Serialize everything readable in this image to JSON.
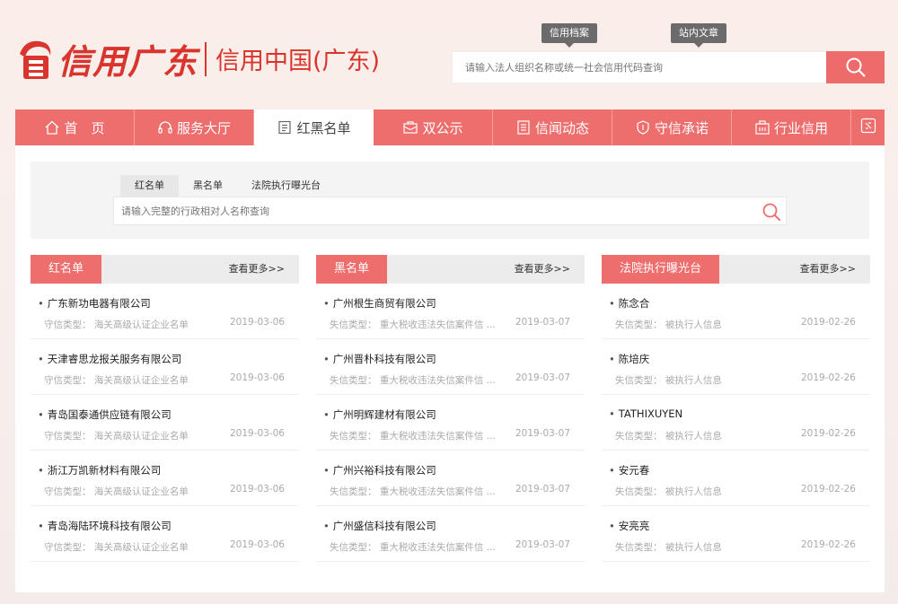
{
  "header": {
    "logo_script": "信用广东",
    "logo_sub": "信用中国(广东)",
    "top_tabs": [
      {
        "label": "信用档案"
      },
      {
        "label": "站内文章"
      }
    ],
    "search": {
      "placeholder": "请输入法人组织名称或统一社会信用代码查询"
    }
  },
  "nav": {
    "items": [
      {
        "label": "首　页",
        "icon": "home-icon"
      },
      {
        "label": "服务大厅",
        "icon": "headset-icon"
      },
      {
        "label": "红黑名单",
        "icon": "list-icon",
        "active": true
      },
      {
        "label": "双公示",
        "icon": "mail-icon"
      },
      {
        "label": "信闻动态",
        "icon": "document-icon"
      },
      {
        "label": "守信承诺",
        "icon": "shield-icon"
      },
      {
        "label": "行业信用",
        "icon": "building-icon"
      }
    ],
    "end_icon": "collapse-icon"
  },
  "search_panel": {
    "tabs": [
      "红名单",
      "黑名单",
      "法院执行曝光台"
    ],
    "active_tab": "红名单",
    "placeholder": "请输入完整的行政相对人名称查询"
  },
  "columns": [
    {
      "title": "红名单",
      "more": "查看更多>>",
      "items": [
        {
          "name": "广东新功电器有限公司",
          "sub": "守信类型：  海关高级认证企业名单",
          "date": "2019-03-06"
        },
        {
          "name": "天津睿思龙报关服务有限公司",
          "sub": "守信类型：  海关高级认证企业名单",
          "date": "2019-03-06"
        },
        {
          "name": "青岛国泰通供应链有限公司",
          "sub": "守信类型：  海关高级认证企业名单",
          "date": "2019-03-06"
        },
        {
          "name": "浙江万凯新材料有限公司",
          "sub": "守信类型：  海关高级认证企业名单",
          "date": "2019-03-06"
        },
        {
          "name": "青岛海陆环境科技有限公司",
          "sub": "守信类型：  海关高级认证企业名单",
          "date": "2019-03-06"
        }
      ]
    },
    {
      "title": "黑名单",
      "more": "查看更多>>",
      "items": [
        {
          "name": "广州根生商贸有限公司",
          "sub": "失信类型：  重大税收违法失信案件信 ...",
          "date": "2019-03-07"
        },
        {
          "name": "广州晋朴科技有限公司",
          "sub": "失信类型：  重大税收违法失信案件信 ...",
          "date": "2019-03-07"
        },
        {
          "name": "广州明辉建材有限公司",
          "sub": "失信类型：  重大税收违法失信案件信 ...",
          "date": "2019-03-07"
        },
        {
          "name": "广州兴裕科技有限公司",
          "sub": "失信类型：  重大税收违法失信案件信 ...",
          "date": "2019-03-07"
        },
        {
          "name": "广州盛信科技有限公司",
          "sub": "失信类型：  重大税收违法失信案件信 ...",
          "date": "2019-03-07"
        }
      ]
    },
    {
      "title": "法院执行曝光台",
      "more": "查看更多>>",
      "items": [
        {
          "name": "陈念合",
          "sub": "失信类型：  被执行人信息",
          "date": "2019-02-26"
        },
        {
          "name": "陈培庆",
          "sub": "失信类型：  被执行人信息",
          "date": "2019-02-26"
        },
        {
          "name": "TATHIXUYEN",
          "sub": "失信类型：  被执行人信息",
          "date": "2019-02-26"
        },
        {
          "name": "安元春",
          "sub": "失信类型：  被执行人信息",
          "date": "2019-02-26"
        },
        {
          "name": "安亮亮",
          "sub": "失信类型：  被执行人信息",
          "date": "2019-02-26"
        }
      ]
    }
  ],
  "colors": {
    "accent": "#ee6e6e",
    "brand_red": "#d9352e"
  }
}
